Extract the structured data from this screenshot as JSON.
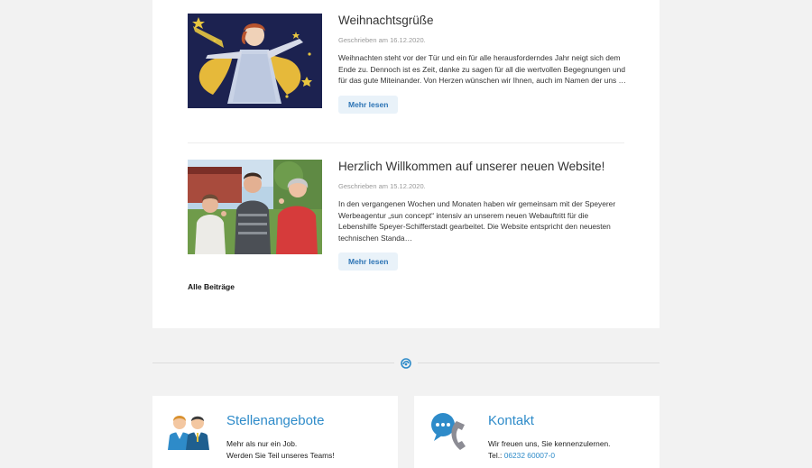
{
  "posts": [
    {
      "title": "Weihnachtsgrüße",
      "date": "Geschrieben am 16.12.2020.",
      "excerpt": "Weihnachten steht vor der Tür und ein für alle herausforderndes Jahr neigt sich dem Ende zu. Dennoch ist es Zeit, danke zu sagen für all die wertvollen Begegnungen und für das gute Miteinander. Von Herzen wünschen wir Ihnen, auch im Namen der uns …",
      "more_label": "Mehr lesen"
    },
    {
      "title": "Herzlich Willkommen auf unserer neuen Website!",
      "date": "Geschrieben am 15.12.2020.",
      "excerpt": "In den vergangenen Wochen und Monaten haben wir gemeinsam mit der Speyerer Werbeagentur „sun concept“ intensiv an unserem neuen Webauftritt für die Lebenshilfe Speyer-Schifferstadt gearbeitet. Die Website entspricht den neuesten technischen Standa…",
      "more_label": "Mehr lesen"
    }
  ],
  "all_posts_label": "Alle Beiträge",
  "jobs_card": {
    "title": "Stellenangebote",
    "line1": "Mehr als nur ein Job.",
    "line2": "Werden Sie Teil unseres Teams!"
  },
  "contact_card": {
    "title": "Kontakt",
    "line1": "Wir freuen uns, Sie kennenzulernen.",
    "tel_label": "Tel.: ",
    "tel_value": "06232 60007-0"
  },
  "icons": {
    "divider": "lebenshilfe-logo-icon",
    "jobs": "team-people-icon",
    "contact": "phone-chat-icon"
  },
  "colors": {
    "accent": "#2e8bc9",
    "button_bg": "#e9f2f9",
    "page_bg": "#f2f2f2"
  }
}
